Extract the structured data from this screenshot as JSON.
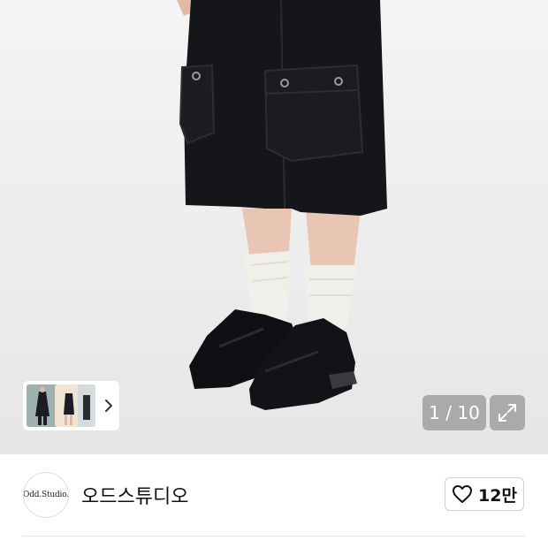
{
  "gallery": {
    "counter": "1 / 10",
    "thumbnail_count": 3
  },
  "icons": {
    "thumb_arrow": "chevron-right-icon",
    "expand": "expand-arrows-icon",
    "like": "heart-outline-icon"
  },
  "store": {
    "logo_text": "Odd.Studio.",
    "name": "오드스튜디오",
    "likes": "12만"
  }
}
